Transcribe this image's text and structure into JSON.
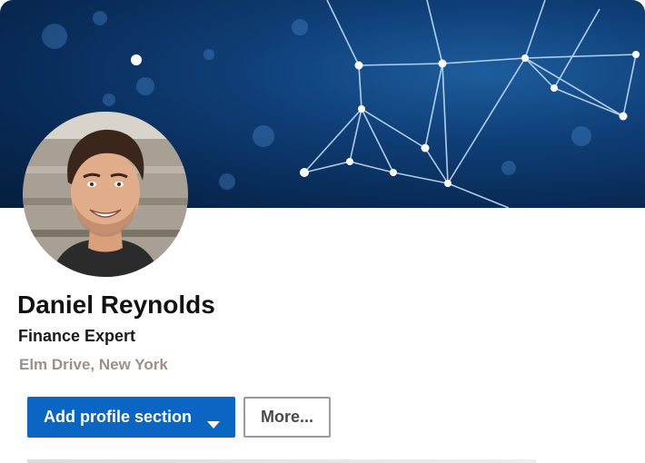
{
  "profile": {
    "name": "Daniel Reynolds",
    "headline": "Finance Expert",
    "location": "Elm Drive, New York"
  },
  "actions": {
    "add_section_label": "Add profile section",
    "more_label": "More..."
  },
  "icons": {
    "dropdown": "caret-down-icon"
  },
  "colors": {
    "primary_button": "#0a66c2",
    "banner": "#0b3566",
    "location_text": "#9b9187"
  }
}
